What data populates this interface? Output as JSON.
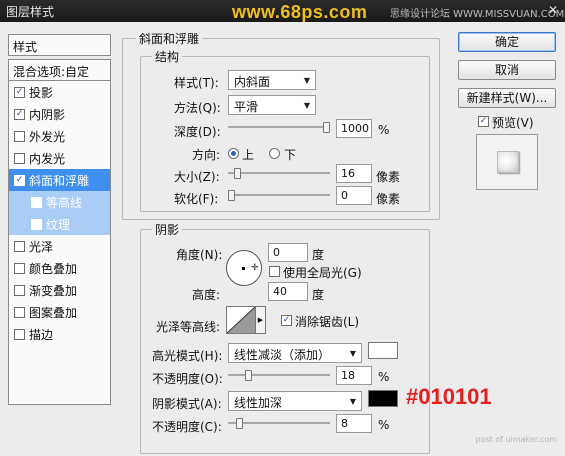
{
  "window": {
    "title": "图层样式",
    "site_banner": "www.68ps.com",
    "forum_text": "思缘设计论坛 WWW.MISSVUAN.COM",
    "close_glyph": "✕"
  },
  "left_panel": {
    "header": "样式",
    "blend_options": "混合选项:自定",
    "items": [
      {
        "label": "投影",
        "checked": true
      },
      {
        "label": "内阴影",
        "checked": true
      },
      {
        "label": "外发光",
        "checked": false
      },
      {
        "label": "内发光",
        "checked": false
      },
      {
        "label": "斜面和浮雕",
        "checked": true,
        "selected": true
      },
      {
        "label": "等高线",
        "checked": false,
        "sub": true
      },
      {
        "label": "纹理",
        "checked": false,
        "sub": true
      },
      {
        "label": "光泽",
        "checked": false
      },
      {
        "label": "颜色叠加",
        "checked": false
      },
      {
        "label": "渐变叠加",
        "checked": false
      },
      {
        "label": "图案叠加",
        "checked": false
      },
      {
        "label": "描边",
        "checked": false
      }
    ]
  },
  "bevel": {
    "group_title": "斜面和浮雕",
    "structure_title": "结构",
    "style_label": "样式(T):",
    "style_value": "内斜面",
    "method_label": "方法(Q):",
    "method_value": "平滑",
    "depth_label": "深度(D):",
    "depth_value": "1000",
    "depth_unit": "%",
    "depth_level": 1.0,
    "direction_label": "方向:",
    "direction_up": "上",
    "direction_down": "下",
    "direction_selected": "up",
    "size_label": "大小(Z):",
    "size_value": "16",
    "size_unit": "像素",
    "size_level": 0.065,
    "soften_label": "软化(F):",
    "soften_value": "0",
    "soften_unit": "像素",
    "soften_level": 0.0
  },
  "shading": {
    "title": "阴影",
    "angle_label": "角度(N):",
    "angle_value": "0",
    "angle_unit": "度",
    "global_light_label": "使用全局光(G)",
    "global_light_checked": false,
    "altitude_label": "高度:",
    "altitude_value": "40",
    "altitude_unit": "度",
    "gloss_contour_label": "光泽等高线:",
    "antialias_label": "消除锯齿(L)",
    "antialias_checked": true,
    "highlight_mode_label": "高光模式(H):",
    "highlight_mode_value": "线性减淡（添加）",
    "highlight_color": "#ffffff",
    "highlight_opacity_label": "不透明度(O):",
    "highlight_opacity_value": "18",
    "highlight_opacity_unit": "%",
    "highlight_opacity_level": 0.18,
    "shadow_mode_label": "阴影模式(A):",
    "shadow_mode_value": "线性加深",
    "shadow_color": "#010101",
    "shadow_opacity_label": "不透明度(C):",
    "shadow_opacity_value": "8",
    "shadow_opacity_unit": "%",
    "shadow_opacity_level": 0.08,
    "annotation": "#010101"
  },
  "buttons": {
    "ok": "确定",
    "cancel": "取消",
    "new_style": "新建样式(W)...",
    "preview_label": "预览(V)",
    "preview_checked": true
  },
  "watermark": "post of uimaker.com",
  "colors": {
    "accent": "#3e8ff0",
    "annotation": "#e22020"
  }
}
